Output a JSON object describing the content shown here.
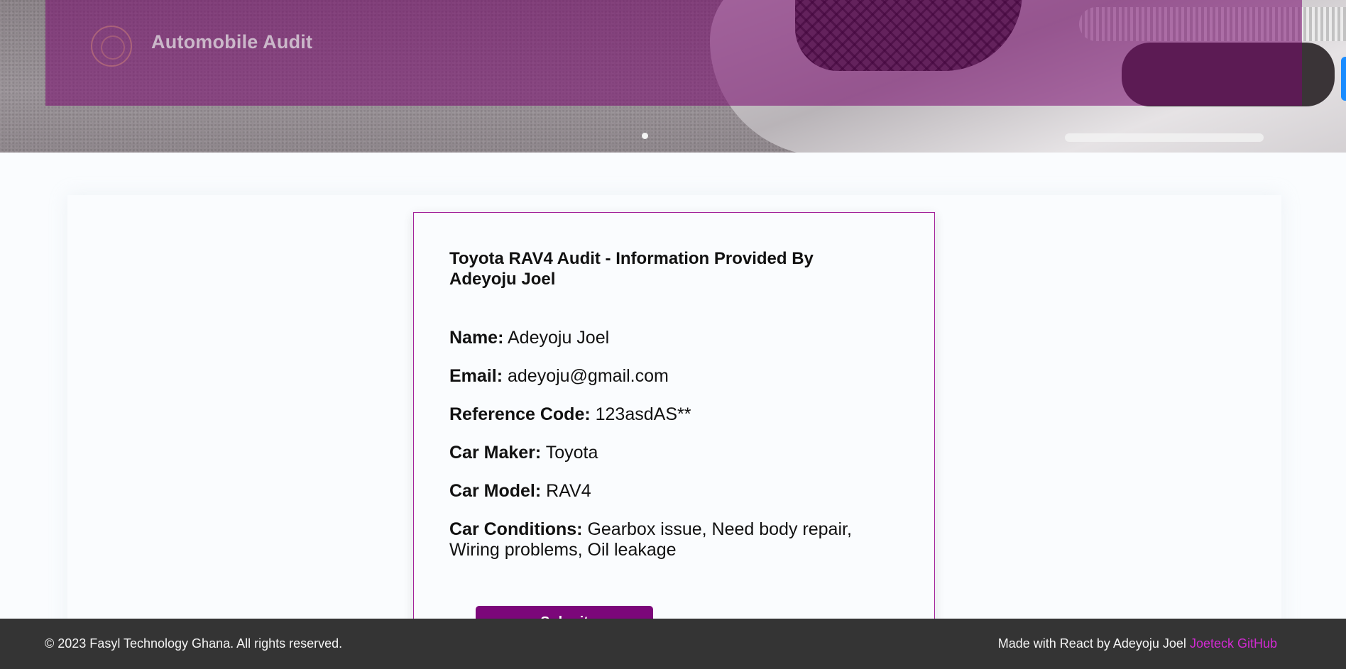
{
  "header": {
    "brand_title": "Automobile Audit",
    "logo_icon": "emblem-icon",
    "overlay_color": "#78086e",
    "carousel_active_index": 1
  },
  "audit": {
    "title": "Toyota RAV4 Audit - Information Provided By Adeyoju Joel",
    "fields": [
      {
        "label": "Name:",
        "value": "Adeyoju Joel"
      },
      {
        "label": "Email:",
        "value": "adeyoju@gmail.com"
      },
      {
        "label": "Reference Code:",
        "value": "123asdAS**"
      },
      {
        "label": "Car Maker:",
        "value": "Toyota"
      },
      {
        "label": "Car Model:",
        "value": "RAV4"
      },
      {
        "label": "Car Conditions:",
        "value": "Gearbox issue, Need body repair, Wiring problems, Oil leakage"
      }
    ],
    "submit_label": "Submit",
    "accent_color": "#7c077a"
  },
  "footer": {
    "copyright": "© 2023 Fasyl Technology Ghana. All rights reserved.",
    "made_with": "Made with React by Adeyoju Joel",
    "github_link": "Joeteck GitHub",
    "link_color": "#d22ad2"
  }
}
